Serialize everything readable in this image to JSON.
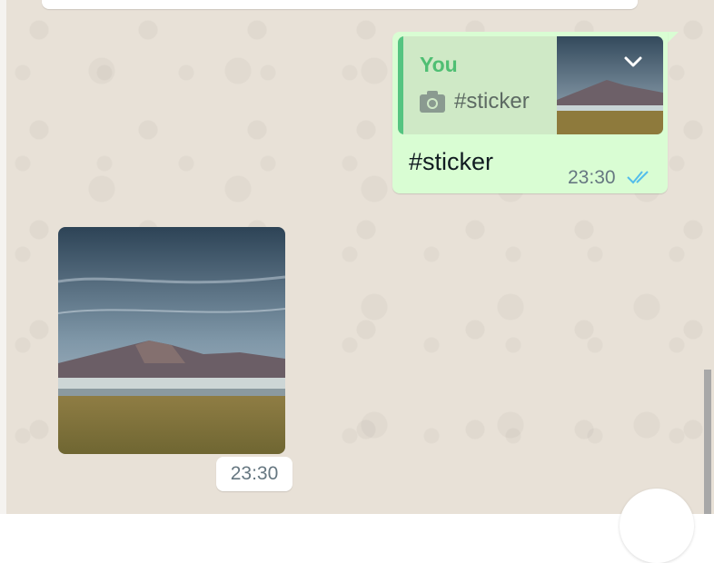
{
  "outgoing_message": {
    "quote_author": "You",
    "quote_icon": "camera-icon",
    "quote_text": "#sticker",
    "text": "#sticker",
    "time": "23:30",
    "status_icon": "double-check-icon"
  },
  "incoming_sticker": {
    "time": "23:30"
  },
  "colors": {
    "outgoing_bubble": "#d9fdd3",
    "quote_accent": "#55c481",
    "read_ticks": "#53bdeb",
    "chat_background": "#e8e1d7"
  }
}
